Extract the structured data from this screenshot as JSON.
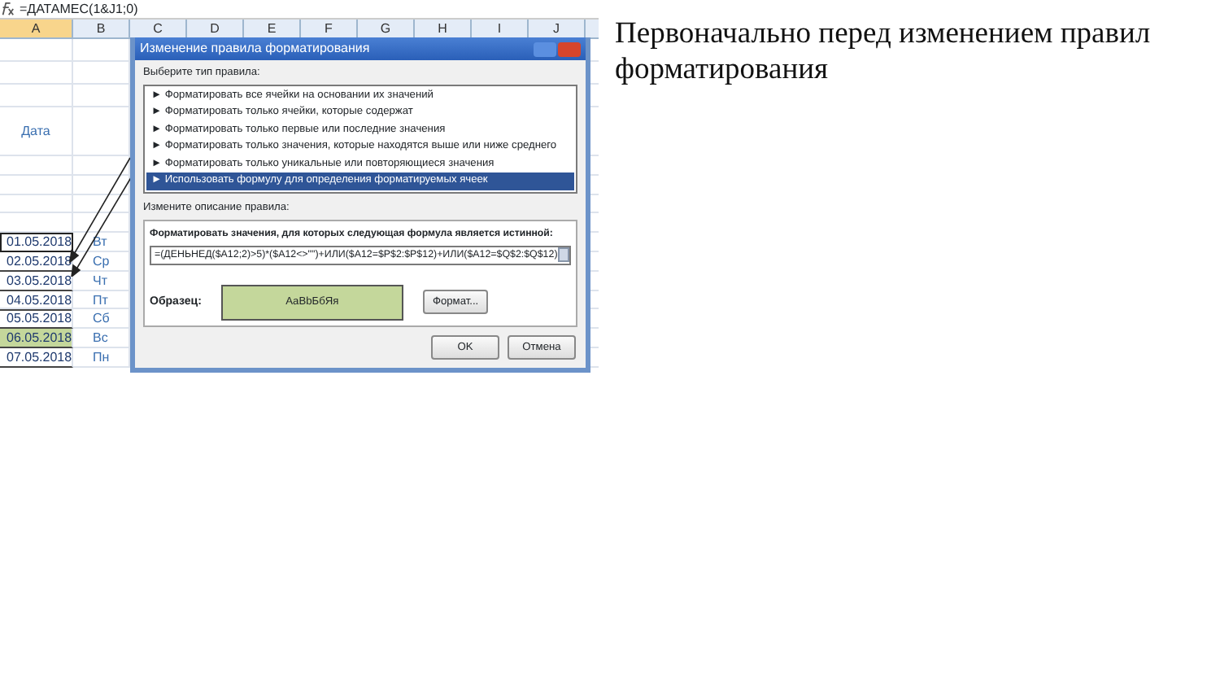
{
  "formula_bar": {
    "formula": "=ДАТАМЕС(1&J1;0)"
  },
  "sheet": {
    "columns": [
      "A",
      "B",
      "C",
      "D",
      "E",
      "F",
      "G",
      "H",
      "I",
      "J"
    ],
    "header_label": "Дата",
    "rows": [
      {
        "date": "01.05.2018",
        "day": "Вт",
        "selected": true,
        "highlighted": false
      },
      {
        "date": "02.05.2018",
        "day": "Ср",
        "selected": false,
        "highlighted": false
      },
      {
        "date": "03.05.2018",
        "day": "Чт",
        "selected": false,
        "highlighted": false
      },
      {
        "date": "04.05.2018",
        "day": "Пт",
        "selected": false,
        "highlighted": false
      },
      {
        "date": "05.05.2018",
        "day": "Сб",
        "selected": false,
        "highlighted": false
      },
      {
        "date": "06.05.2018",
        "day": "Вс",
        "selected": false,
        "highlighted": true
      },
      {
        "date": "07.05.2018",
        "day": "Пн",
        "selected": false,
        "highlighted": false
      }
    ]
  },
  "dialog": {
    "title": "Изменение правила форматирования",
    "rule_type_label": "Выберите тип правила:",
    "rule_types": [
      {
        "label": "► Форматировать все ячейки на основании их значений",
        "selected": false
      },
      {
        "label": "► Форматировать только ячейки, которые содержат",
        "selected": false
      },
      {
        "label": "► Форматировать только первые или последние значения",
        "selected": false
      },
      {
        "label": "► Форматировать только значения, которые находятся выше или ниже среднего",
        "selected": false
      },
      {
        "label": "► Форматировать только уникальные или повторяющиеся значения",
        "selected": false
      },
      {
        "label": "► Использовать формулу для определения форматируемых ячеек",
        "selected": true
      }
    ],
    "description_label": "Измените описание правила:",
    "formula_label": "Форматировать значения, для которых следующая формула является истинной:",
    "formula": "=(ДЕНЬНЕД($A12;2)>5)*($A12<>\"\")+ИЛИ($A12=$P$2:$P$12)+ИЛИ($A12=$Q$2:$Q$12)",
    "preview_label": "Образец:",
    "preview_text": "AaBbБбЯя",
    "format_button": "Формат...",
    "buttons": [
      "OK",
      "Отмена"
    ]
  },
  "caption": "Первоначально перед изменением правил форматирования"
}
